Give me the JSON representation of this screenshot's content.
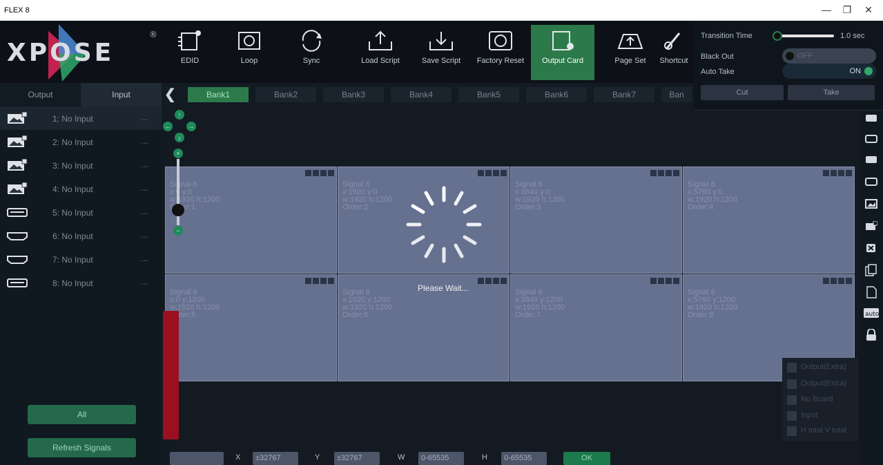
{
  "window": {
    "title": "FLEX 8",
    "minimize": "—",
    "restore": "❐",
    "close": "✕"
  },
  "logo": {
    "text": "XPOSE",
    "registered": "®"
  },
  "toolbar": {
    "items": [
      {
        "label": "EDID",
        "icon": "edid-icon"
      },
      {
        "label": "Loop",
        "icon": "loop-icon"
      },
      {
        "label": "Sync",
        "icon": "sync-icon"
      },
      {
        "label": "Load Script",
        "icon": "load-script-icon"
      },
      {
        "label": "Save Script",
        "icon": "save-script-icon"
      },
      {
        "label": "Factory Reset",
        "icon": "factory-reset-icon"
      },
      {
        "label": "Output Card",
        "icon": "output-card-icon",
        "active": true
      },
      {
        "label": "Page Set",
        "icon": "page-set-icon"
      },
      {
        "label": "Shortcut",
        "icon": "shortcut-icon"
      }
    ]
  },
  "left_tabs": {
    "output": "Output",
    "input": "Input"
  },
  "inputs": [
    {
      "label": "1: No Input",
      "more": "...",
      "icon": "picture-input-icon"
    },
    {
      "label": "2: No Input",
      "more": "...",
      "icon": "picture-input-icon"
    },
    {
      "label": "3: No Input",
      "more": "...",
      "icon": "picture-input-icon"
    },
    {
      "label": "4: No Input",
      "more": "...",
      "icon": "picture-input-icon"
    },
    {
      "label": "5: No Input",
      "more": "...",
      "icon": "dvi-input-icon"
    },
    {
      "label": "6: No Input",
      "more": "...",
      "icon": "hdmi-input-icon"
    },
    {
      "label": "7: No Input",
      "more": "...",
      "icon": "hdmi-input-icon"
    },
    {
      "label": "8: No Input",
      "more": "...",
      "icon": "dvi-input-icon"
    }
  ],
  "left_buttons": {
    "all": "All",
    "refresh": "Refresh Signals"
  },
  "banks": [
    "Bank1",
    "Bank2",
    "Bank3",
    "Bank4",
    "Bank5",
    "Bank6",
    "Bank7",
    "Ban"
  ],
  "cells": [
    {
      "signal": "Signal 6",
      "xy": "x:0  y:0",
      "wh": "w:1920  h:1200",
      "order": "Order:1"
    },
    {
      "signal": "Signal 6",
      "xy": "x:1920  y:0",
      "wh": "w:1920  h:1200",
      "order": "Order:2"
    },
    {
      "signal": "Signal 6",
      "xy": "x:3840  y:0",
      "wh": "w:1920  h:1200",
      "order": "Order:3"
    },
    {
      "signal": "Signal 6",
      "xy": "x:5760  y:0",
      "wh": "w:1920  h:1200",
      "order": "Order:4"
    },
    {
      "signal": "Signal 6",
      "xy": "x:0  y:1200",
      "wh": "w:1920  h:1200",
      "order": "Order:5"
    },
    {
      "signal": "Signal 6",
      "xy": "x:1920  y:1200",
      "wh": "w:1920  h:1200",
      "order": "Order:6"
    },
    {
      "signal": "Signal 6",
      "xy": "x:3840  y:1200",
      "wh": "w:1920  h:1200",
      "order": "Order:7"
    },
    {
      "signal": "Signal 6",
      "xy": "x:5760  y:1200",
      "wh": "w:1920  h:1200",
      "order": "Order:8"
    }
  ],
  "loading": {
    "text": "Please Wait..."
  },
  "legend": {
    "items": [
      "Output(Extra)",
      "Output(Extra)",
      "No Board",
      "Input",
      "H total V total"
    ]
  },
  "side_icons": [
    "monitor-icon",
    "monitor-icon",
    "monitor-icon",
    "monitor-icon",
    "picture-icon",
    "picture-x-icon",
    "close-box-icon",
    "copy-icon",
    "document-icon",
    "auto-icon",
    "lock-icon"
  ],
  "bottom": {
    "x_label": "X",
    "x_placeholder": "±32767",
    "y_label": "Y",
    "y_placeholder": "±32767",
    "w_label": "W",
    "w_placeholder": "0-65535",
    "h_label": "H",
    "h_placeholder": "0-65535",
    "ok": "OK"
  },
  "popup": {
    "transition_label": "Transition Time",
    "transition_value": "1.0 sec",
    "black_out_label": "Black Out",
    "black_out_state": "OFF",
    "auto_take_label": "Auto Take",
    "auto_take_state": "ON",
    "cut": "Cut",
    "take": "Take"
  },
  "colors": {
    "accent": "#2c7a4a",
    "cell": "#66708f",
    "danger": "#9a1020"
  }
}
